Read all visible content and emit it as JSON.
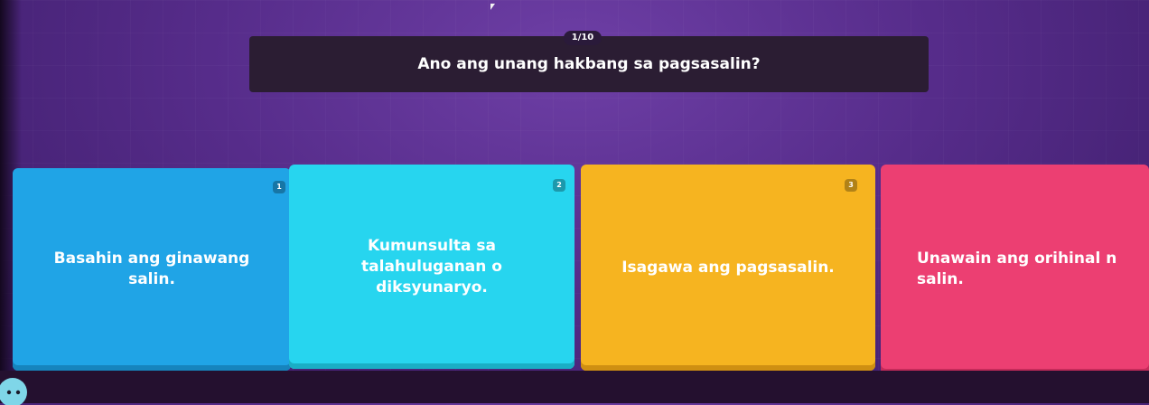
{
  "quiz": {
    "counter": "1/10",
    "question": "Ano ang unang hakbang sa pagsasalin?"
  },
  "options": [
    {
      "number": "1",
      "text": "Basahin ang ginawang salin.",
      "color": "#20a4e6"
    },
    {
      "number": "2",
      "text": "Kumunsulta sa talahuluganan o diksyunaryo.",
      "color": "#27d5ef"
    },
    {
      "number": "3",
      "text": "Isagawa ang pagsasalin.",
      "color": "#f6b420"
    },
    {
      "number": "",
      "text": "Unawain ang orihinal n salin.",
      "color": "#ec3f72"
    }
  ],
  "icons": {
    "cursor": "arrow-cursor-icon",
    "avatar": "player-avatar-icon"
  }
}
